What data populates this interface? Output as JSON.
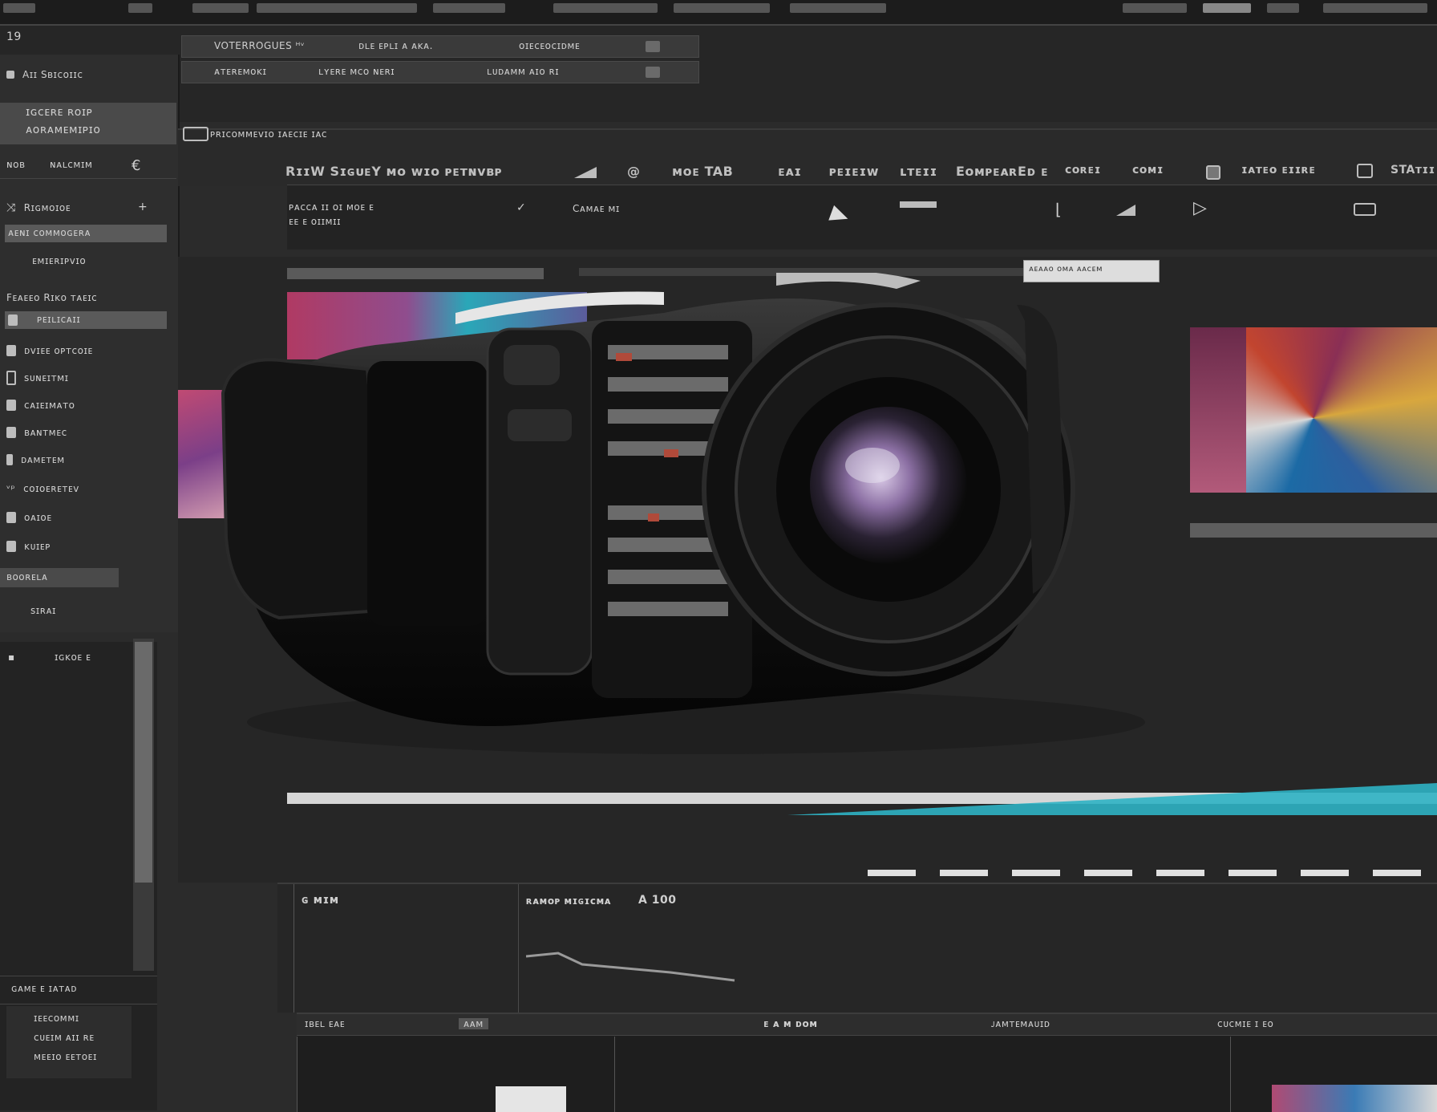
{
  "window": {
    "number": "19"
  },
  "top_fields": {
    "row1_left": "VOTERROGUES ᴴᵛ",
    "row1_mid": "ᴅʟᴇ ᴇᴘʟɪ ᴀ ᴀᴋᴀ.",
    "row1_right": "ᴏɪᴇᴄᴇᴏᴄɪᴅᴍᴇ",
    "row2_left": "ᴀᴛᴇʀᴇᴍᴏᴋɪ",
    "row2_mid": "ʟʏᴇʀᴇ ᴍᴄᴏ ɴᴇʀɪ",
    "row2_right": "ʟᴜᴅᴀᴍᴍ ᴀɪᴏ ʀɪ"
  },
  "left_panel": {
    "header": "Aɪɪ  Sʙɪᴄᴏɪɪᴄ",
    "section_title_1": "ɪɢᴄᴇʀᴇ ʀᴏɪᴘ",
    "section_title_2": "ᴀᴏʀᴀᴍᴇᴍɪᴘɪᴏ",
    "tabs": [
      "ɴᴏʙ",
      "ɴᴀʟᴄᴍɪᴍ"
    ],
    "subheader": "Rɪɢᴍᴏɪᴏᴇ",
    "highlighted_label": "ᴀᴇɴɪ ᴄᴏᴍᴍᴏɢᴇʀᴀ",
    "sub_label": "ᴇᴍɪᴇʀɪᴘᴠɪᴏ",
    "group_label": "Fᴇᴀᴇᴇᴏ Rɪᴋᴏ ᴛᴀᴇɪᴄ",
    "selected_item": "ᴘᴇɪʟɪᴄᴀɪɪ",
    "items": [
      "ᴅᴠɪᴇᴇ ᴏᴘᴛᴄᴏɪᴇ",
      "ꜱᴜɴᴇɪᴛᴍɪ",
      "ᴄᴀɪᴇɪᴍᴀᴛᴏ",
      "ʙᴀɴᴛᴍᴇᴄ",
      "ᴅᴀᴍᴇᴛᴇᴍ",
      "ᴄᴏɪᴏᴇʀᴇᴛᴇᴠ",
      "ᴏᴀɪᴏᴇ",
      "ᴋᴜɪᴇᴘ"
    ],
    "footer_highlight": "ʙᴏᴏʀᴇʟᴀ",
    "footer_item": "ꜱɪʀᴀɪ",
    "timeline_track": "ɪɢᴋᴏᴇ ᴇ"
  },
  "toolbar": {
    "path": "ᴘʀɪᴄᴏᴍᴍᴇᴠɪᴏ   ɪᴀᴇᴄɪᴇ ɪᴀᴄ",
    "items": [
      "RɪɪW  SɪɢᴜᴇY  ᴍᴏ ᴡɪᴏ  ᴘᴇᴛɴᴠʙᴘ",
      "ᴍᴏᴇ TAB",
      "ᴇᴀɪ",
      "ᴘᴇɪᴇɪᴡ",
      "ʟᴛᴇɪɪ",
      "EᴏᴍᴘᴇᴀʀEᴅ ᴇ",
      "ᴄᴏʀᴇɪ",
      "ᴄᴏᴍɪ",
      "ɪᴀᴛᴇᴏ ᴇɪɪʀᴇ",
      "STAᴛɪɪ"
    ]
  },
  "toolbar2": {
    "info_line1": "ᴘᴀᴄᴄᴀ ɪɪ ᴏɪ ᴍᴏᴇ ᴇ",
    "info_line2": "ᴇᴇ ᴇ ᴏɪɪᴍɪɪ",
    "status": "Cᴀᴍᴀᴇ ᴍɪ"
  },
  "viewer": {
    "badge": "ᴀᴇᴀᴀᴏ ᴏᴍᴀ  ᴀᴀᴄᴇᴍ"
  },
  "timeline": {
    "left_label": "ɢ ᴍɪᴍ",
    "mid_label": "ʀᴀᴍᴏᴘ ᴍɪɢɪᴄᴍᴀ",
    "mid_value": "A 100",
    "track_labels": [
      "ɪʙᴇʟ ᴇᴀᴇ",
      "ᴀᴀᴍ",
      "ᴇ ᴀ ᴍ ᴅᴏᴍ",
      "ᴊᴀᴍᴛᴇᴍᴀᴜɪᴅ",
      "ᴄᴜᴄᴍɪᴇ ɪ ᴇᴏ"
    ]
  },
  "bottom_left": {
    "header": "ɢᴀᴍᴇ  ᴇ ɪᴀᴛᴀᴅ",
    "items": [
      "ɪᴇᴇᴄᴏᴍᴍɪ",
      "ᴄᴜᴇɪᴍ ᴀɪɪ ʀᴇ",
      "ᴍᴇᴇɪᴏ ᴇᴇᴛᴏᴇɪ"
    ]
  },
  "colors": {
    "bg": "#2b2b2b",
    "panel": "#2e2e2e",
    "accent_teal": "#2fb3c4",
    "highlight": "#5a5a5a"
  }
}
